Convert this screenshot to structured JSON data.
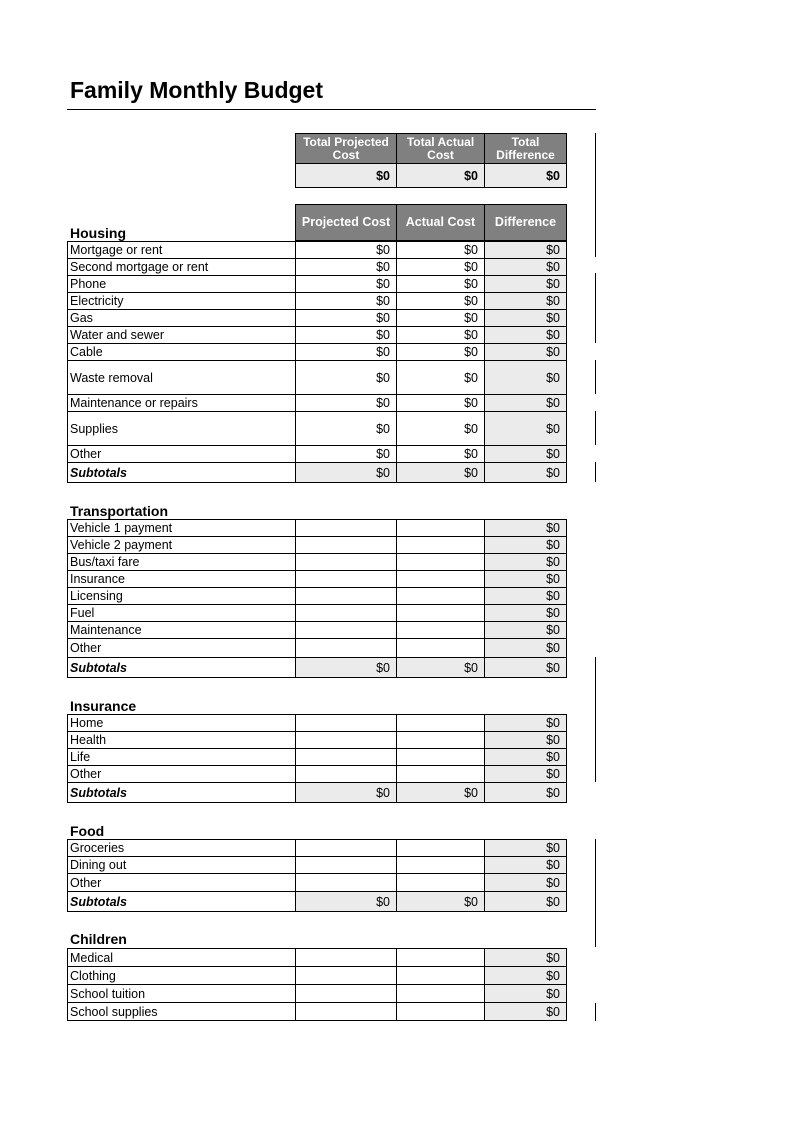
{
  "title": "Family Monthly Budget",
  "totals": {
    "headers": [
      "Total Projected Cost",
      "Total Actual Cost",
      "Total Difference"
    ],
    "values": [
      "$0",
      "$0",
      "$0"
    ]
  },
  "column_headers": [
    "Projected Cost",
    "Actual Cost",
    "Difference"
  ],
  "sections": [
    {
      "name": "Housing",
      "items": [
        {
          "label": "Mortgage or rent",
          "projected": "$0",
          "actual": "$0",
          "difference": "$0"
        },
        {
          "label": "Second mortgage or rent",
          "projected": "$0",
          "actual": "$0",
          "difference": "$0"
        },
        {
          "label": "Phone",
          "projected": "$0",
          "actual": "$0",
          "difference": "$0"
        },
        {
          "label": "Electricity",
          "projected": "$0",
          "actual": "$0",
          "difference": "$0"
        },
        {
          "label": "Gas",
          "projected": "$0",
          "actual": "$0",
          "difference": "$0"
        },
        {
          "label": "Water and sewer",
          "projected": "$0",
          "actual": "$0",
          "difference": "$0"
        },
        {
          "label": "Cable",
          "projected": "$0",
          "actual": "$0",
          "difference": "$0"
        },
        {
          "label": "Waste removal",
          "projected": "$0",
          "actual": "$0",
          "difference": "$0"
        },
        {
          "label": "Maintenance or repairs",
          "projected": "$0",
          "actual": "$0",
          "difference": "$0"
        },
        {
          "label": "Supplies",
          "projected": "$0",
          "actual": "$0",
          "difference": "$0"
        },
        {
          "label": "Other",
          "projected": "$0",
          "actual": "$0",
          "difference": "$0"
        }
      ],
      "subtotal": {
        "label": "Subtotals",
        "projected": "$0",
        "actual": "$0",
        "difference": "$0"
      }
    },
    {
      "name": "Transportation",
      "items": [
        {
          "label": "Vehicle 1 payment",
          "projected": "",
          "actual": "",
          "difference": "$0"
        },
        {
          "label": "Vehicle 2 payment",
          "projected": "",
          "actual": "",
          "difference": "$0"
        },
        {
          "label": "Bus/taxi fare",
          "projected": "",
          "actual": "",
          "difference": "$0"
        },
        {
          "label": "Insurance",
          "projected": "",
          "actual": "",
          "difference": "$0"
        },
        {
          "label": "Licensing",
          "projected": "",
          "actual": "",
          "difference": "$0"
        },
        {
          "label": "Fuel",
          "projected": "",
          "actual": "",
          "difference": "$0"
        },
        {
          "label": "Maintenance",
          "projected": "",
          "actual": "",
          "difference": "$0"
        },
        {
          "label": "Other",
          "projected": "",
          "actual": "",
          "difference": "$0"
        }
      ],
      "subtotal": {
        "label": "Subtotals",
        "projected": "$0",
        "actual": "$0",
        "difference": "$0"
      }
    },
    {
      "name": "Insurance",
      "items": [
        {
          "label": "Home",
          "projected": "",
          "actual": "",
          "difference": "$0"
        },
        {
          "label": "Health",
          "projected": "",
          "actual": "",
          "difference": "$0"
        },
        {
          "label": "Life",
          "projected": "",
          "actual": "",
          "difference": "$0"
        },
        {
          "label": "Other",
          "projected": "",
          "actual": "",
          "difference": "$0"
        }
      ],
      "subtotal": {
        "label": "Subtotals",
        "projected": "$0",
        "actual": "$0",
        "difference": "$0"
      }
    },
    {
      "name": "Food",
      "items": [
        {
          "label": "Groceries",
          "projected": "",
          "actual": "",
          "difference": "$0"
        },
        {
          "label": "Dining out",
          "projected": "",
          "actual": "",
          "difference": "$0"
        },
        {
          "label": "Other",
          "projected": "",
          "actual": "",
          "difference": "$0"
        }
      ],
      "subtotal": {
        "label": "Subtotals",
        "projected": "$0",
        "actual": "$0",
        "difference": "$0"
      }
    },
    {
      "name": "Children",
      "items": [
        {
          "label": "Medical",
          "projected": "",
          "actual": "",
          "difference": "$0"
        },
        {
          "label": "Clothing",
          "projected": "",
          "actual": "",
          "difference": "$0"
        },
        {
          "label": "School tuition",
          "projected": "",
          "actual": "",
          "difference": "$0"
        },
        {
          "label": "School supplies",
          "projected": "",
          "actual": "",
          "difference": "$0"
        }
      ]
    }
  ]
}
